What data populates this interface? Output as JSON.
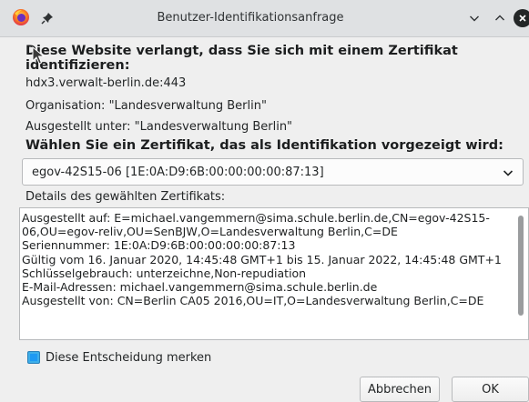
{
  "window": {
    "title": "Benutzer-Identifikationsanfrage",
    "app_icon": "firefox-icon",
    "controls": [
      "pin-icon",
      "chevron-down-icon",
      "chevron-up-icon",
      "close-icon"
    ]
  },
  "dialog": {
    "heading": "Diese Website verlangt, dass Sie sich mit einem Zertifikat identifizieren:",
    "host": "hdx3.verwalt-berlin.de:443",
    "organisation": "Organisation: \"Landesverwaltung Berlin\"",
    "issued_under": "Ausgestellt unter: \"Landesverwaltung Berlin\"",
    "choose_label": "Wählen Sie ein Zertifikat, das als Identifikation vorgezeigt wird:",
    "selected_certificate": "egov-42S15-06 [1E:0A:D9:6B:00:00:00:00:87:13]",
    "details_label": "Details des gewählten Zertifikats:",
    "details_text": "Ausgestellt auf: E=michael.vangemmern@sima.schule.berlin.de,CN=egov-42S15-06,OU=egov-reliv,OU=SenBJW,O=Landesverwaltung Berlin,C=DE\nSeriennummer: 1E:0A:D9:6B:00:00:00:00:87:13\nGültig vom 16. Januar 2020, 14:45:48 GMT+1 bis 15. Januar 2022, 14:45:48 GMT+1\nSchlüsselgebrauch: unterzeichne,Non-repudiation\nE-Mail-Adressen: michael.vangemmern@sima.schule.berlin.de\nAusgestellt von: CN=Berlin CA05 2016,OU=IT,O=Landesverwaltung Berlin,C=DE",
    "remember_label": "Diese Entscheidung merken",
    "remember_checked": true,
    "cancel_label": "Abbrechen",
    "ok_label": "OK"
  },
  "colors": {
    "titlebar": "#dfe1e3",
    "background": "#efefef",
    "accent": "#3daee9"
  }
}
